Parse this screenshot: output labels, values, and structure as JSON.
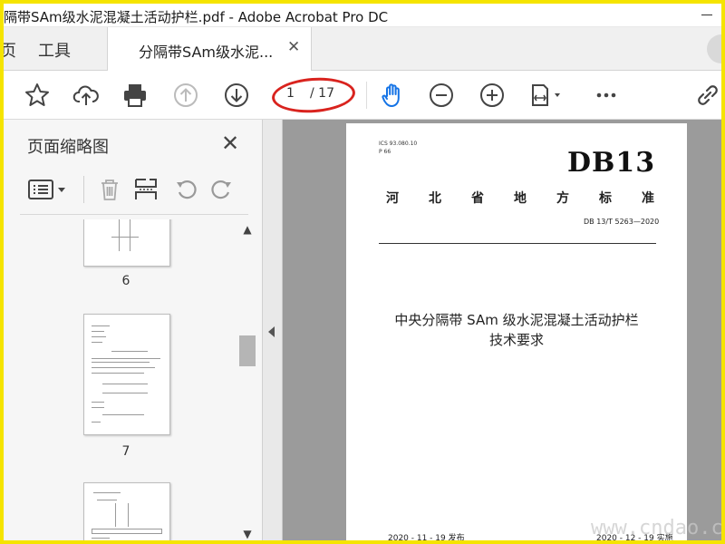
{
  "window": {
    "title": "隔带SAm级水泥混凝土活动护栏.pdf - Adobe Acrobat Pro DC"
  },
  "tabs": {
    "home_label": "页",
    "tools_label": "工具",
    "doc_label": "分隔带SAm级水泥...",
    "close_glyph": "✕"
  },
  "toolbar": {
    "page_current": "1",
    "page_total": "/ 17",
    "icons": [
      "star-icon",
      "cloud-upload-icon",
      "print-icon",
      "arrow-up-icon",
      "arrow-down-icon",
      "hand-icon",
      "zoom-out-icon",
      "zoom-in-icon",
      "fit-page-icon",
      "more-icon",
      "link-icon"
    ]
  },
  "left_panel": {
    "title": "页面缩略图",
    "close_glyph": "✕",
    "thumbnails": [
      {
        "page": "6"
      },
      {
        "page": "7"
      },
      {
        "page": ""
      }
    ]
  },
  "document": {
    "ics": "ICS 93.080.10",
    "p": "P 66",
    "standard_mark": "DB13",
    "province_std": "河北省地方标准",
    "code": "DB 13/T 5263—2020",
    "title_line1": "中央分隔带 SAm 级水泥混凝土活动护栏",
    "title_line2": "技术要求",
    "issue_date": "2020 - 11 - 19 发布",
    "impl_date": "2020 - 12 - 19 实施"
  },
  "watermark": "www.cndao.c",
  "colors": {
    "frame_border": "#f5e400",
    "highlight_oval": "#d9231e",
    "hand_tool": "#1473e6"
  }
}
